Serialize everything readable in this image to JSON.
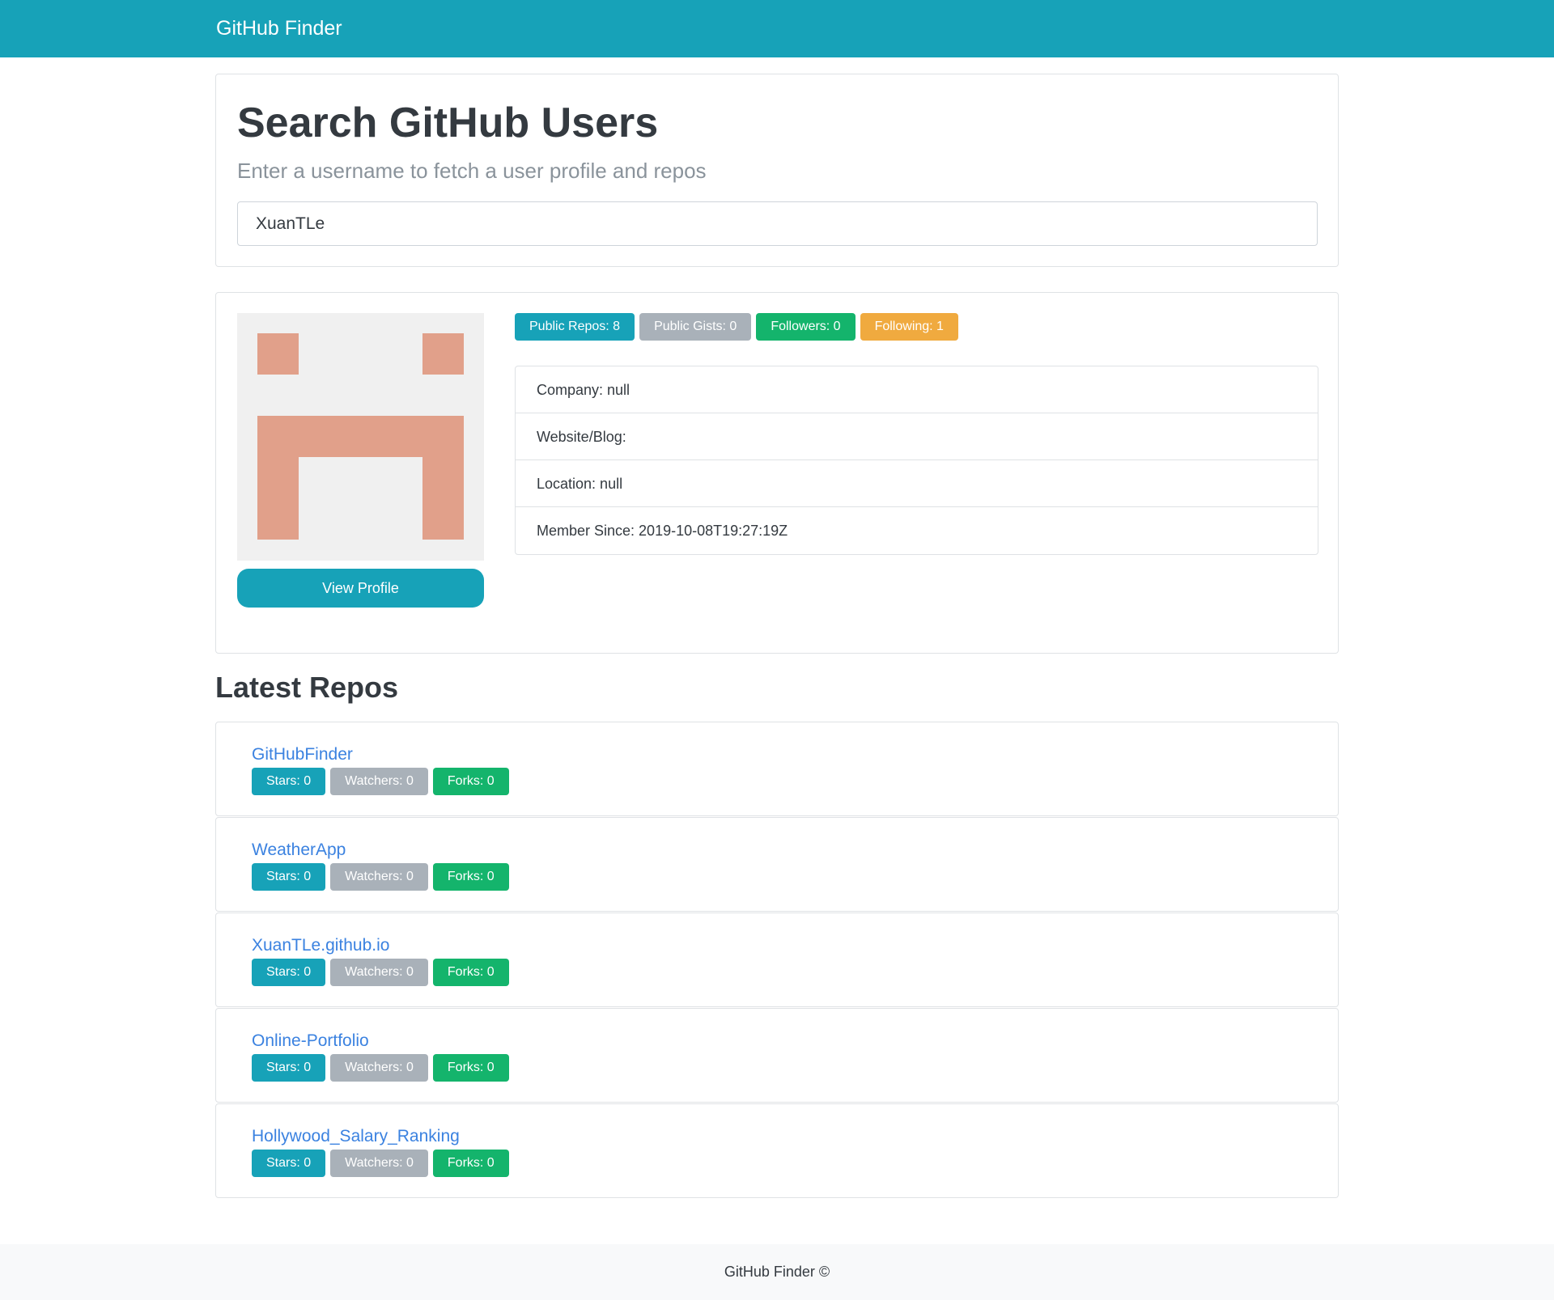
{
  "navbar": {
    "brand": "GitHub Finder"
  },
  "search": {
    "title": "Search GitHub Users",
    "subtitle": "Enter a username to fetch a user profile and repos",
    "input_value": "XuanTLe"
  },
  "profile": {
    "view_profile_label": "View Profile",
    "badges": {
      "public_repos": "Public Repos: 8",
      "public_gists": "Public Gists: 0",
      "followers": "Followers: 0",
      "following": "Following: 1"
    },
    "info": {
      "company": "Company: null",
      "website": "Website/Blog:",
      "location": "Location: null",
      "member_since": "Member Since: 2019-10-08T19:27:19Z"
    },
    "colors": {
      "avatar_fg": "#e1a08a",
      "avatar_bg": "#f0f0f0"
    }
  },
  "repos": {
    "heading": "Latest Repos",
    "items": [
      {
        "name": "GitHubFinder",
        "stars": "Stars: 0",
        "watchers": "Watchers: 0",
        "forks": "Forks: 0"
      },
      {
        "name": "WeatherApp",
        "stars": "Stars: 0",
        "watchers": "Watchers: 0",
        "forks": "Forks: 0"
      },
      {
        "name": "XuanTLe.github.io",
        "stars": "Stars: 0",
        "watchers": "Watchers: 0",
        "forks": "Forks: 0"
      },
      {
        "name": "Online-Portfolio",
        "stars": "Stars: 0",
        "watchers": "Watchers: 0",
        "forks": "Forks: 0"
      },
      {
        "name": "Hollywood_Salary_Ranking",
        "stars": "Stars: 0",
        "watchers": "Watchers: 0",
        "forks": "Forks: 0"
      }
    ]
  },
  "footer": {
    "text": "GitHub Finder ©"
  },
  "theme": {
    "primary": "#17a2b8",
    "secondary": "#a9b1b9",
    "success": "#14b46c",
    "warning": "#f0aa3f",
    "link": "#3b82e0"
  }
}
